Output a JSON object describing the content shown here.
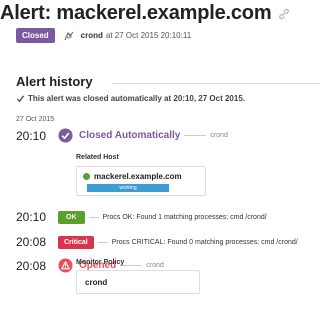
{
  "header": {
    "title": "Alert: mackerel.example.com",
    "status_badge": "Closed",
    "user": "crond",
    "timestamp": "at 27 Oct 2015 20:10:11"
  },
  "history": {
    "section_title": "Alert history",
    "auto_closed_note": "This alert was closed automatically at 20:10, 27 Oct 2015.",
    "date": "27 Oct 2015",
    "events": [
      {
        "time": "20:10",
        "label": "Closed Automatically",
        "user": "crond",
        "related_host_label": "Related Host",
        "host_name": "mackerel.example.com",
        "host_status": "working"
      },
      {
        "time": "20:10",
        "badge": "OK",
        "message": "Procs OK: Found 1 matching processes; cmd /crond/"
      },
      {
        "time": "20:08",
        "badge": "Critical",
        "message": "Procs CRITICAL: Found 0 matching processes; cmd /crond/"
      },
      {
        "time": "20:08",
        "label": "Opened",
        "user": "crond",
        "monitor_policy_label": "Monitor Policy",
        "monitor_name": "crond"
      }
    ]
  },
  "colors": {
    "closed": "#7a5a9e",
    "ok": "#5aa02c",
    "critical": "#d9354a",
    "opened": "#e8505b",
    "working": "#3d9cd1"
  }
}
